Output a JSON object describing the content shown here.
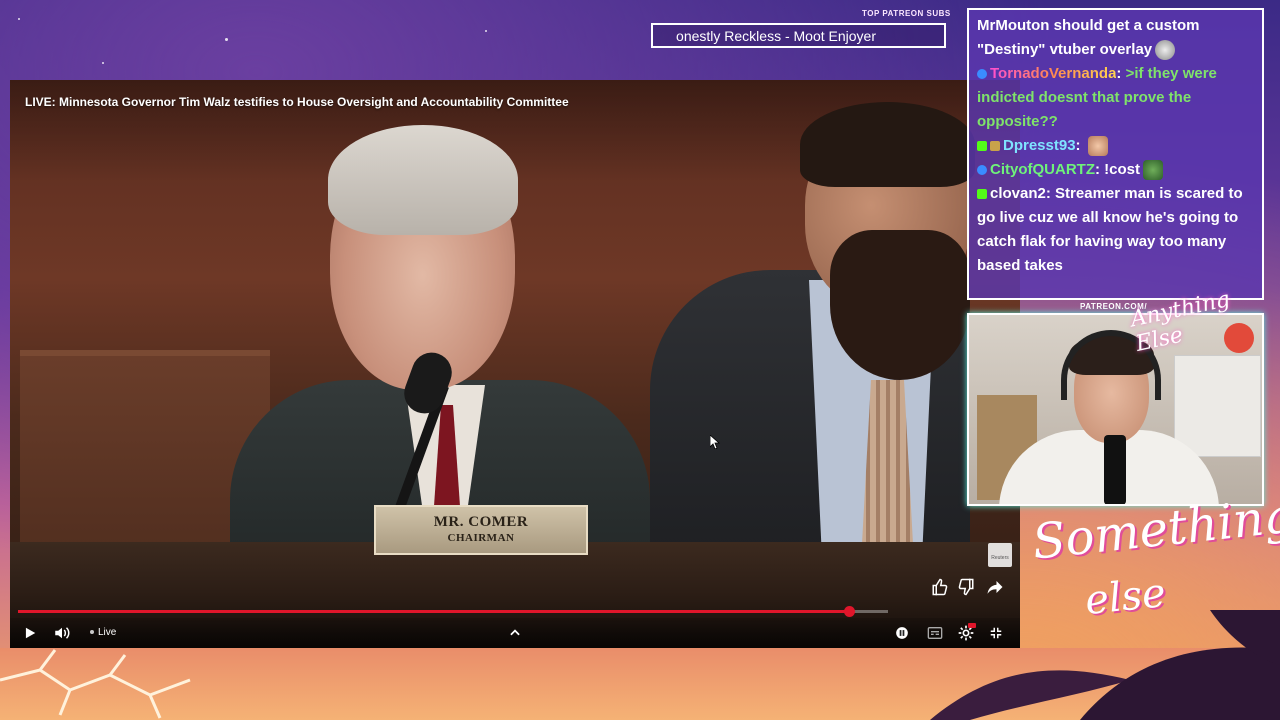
{
  "subs": {
    "label": "TOP PATREON SUBS",
    "ticker": "onestly Reckless - Moot Enjoyer"
  },
  "player": {
    "title": "LIVE: Minnesota Governor Tim Walz testifies to House Oversight and Accountability Committee",
    "nameplate_name": "MR. COMER",
    "nameplate_title": "CHAIRMAN",
    "watermark": "Reuters",
    "live_label": "Live",
    "progress_played": 0.955,
    "icons": {
      "like": "thumbs-up-icon",
      "dislike": "thumbs-down-icon",
      "share": "share-icon",
      "play": "play-icon",
      "volume": "volume-icon",
      "expand": "chevron-up-icon",
      "autoplay": "autoplay-toggle-icon",
      "captions": "captions-icon",
      "settings": "gear-icon",
      "exit_fullscreen": "exit-fullscreen-icon"
    },
    "accent": "#e0162b"
  },
  "chat": {
    "messages": [
      {
        "user": "",
        "text": "MrMouton should get a custom \"Destiny\" vtuber overlay"
      },
      {
        "user": "TornadoVernanda",
        "text": ">if they were indicted doesnt that prove the opposite??"
      },
      {
        "user": "Dpresst93",
        "text": ""
      },
      {
        "user": "CityofQUARTZ",
        "text": "!cost"
      },
      {
        "user": "clovan2",
        "text": "Streamer man is scared to go live cuz we all know he's going to catch flak for having way too many based takes"
      }
    ],
    "separator": ": "
  },
  "overlay": {
    "cam_label": "PATREON.COM/",
    "logo_small": "Anything Else",
    "logo_big_1": "Something",
    "logo_big_2": "else"
  }
}
